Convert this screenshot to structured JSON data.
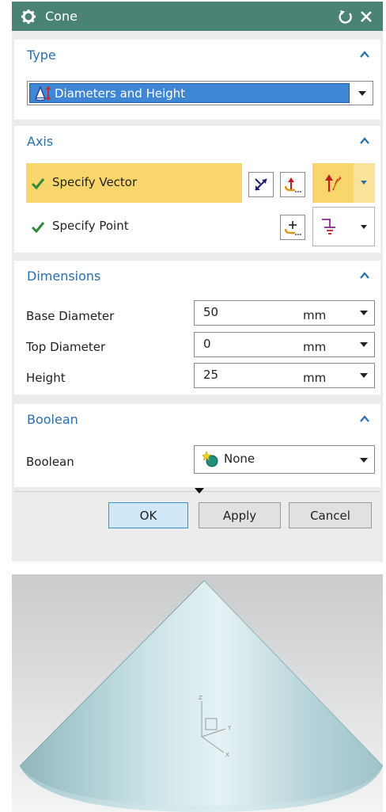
{
  "dialog": {
    "title": "Cone",
    "type_section": {
      "title": "Type",
      "selected": "Diameters and Height"
    },
    "axis_section": {
      "title": "Axis",
      "specify_vector": "Specify Vector",
      "specify_point": "Specify Point"
    },
    "dimensions_section": {
      "title": "Dimensions",
      "fields": [
        {
          "label": "Base Diameter",
          "value": "50",
          "unit": "mm"
        },
        {
          "label": "Top Diameter",
          "value": "0",
          "unit": "mm"
        },
        {
          "label": "Height",
          "value": "25",
          "unit": "mm"
        }
      ]
    },
    "boolean_section": {
      "title": "Boolean",
      "label": "Boolean",
      "value": "None"
    },
    "buttons": {
      "ok": "OK",
      "apply": "Apply",
      "cancel": "Cancel"
    }
  },
  "viewport": {
    "axis_labels": {
      "y": "Y",
      "x": "X",
      "z": "Z"
    }
  },
  "colors": {
    "titlebar": "#4a8275",
    "section_title": "#2b6fa8",
    "selected_row": "#f9d66b",
    "combo_selected": "#3f86d4",
    "ok_button": "#cfe7f7"
  }
}
